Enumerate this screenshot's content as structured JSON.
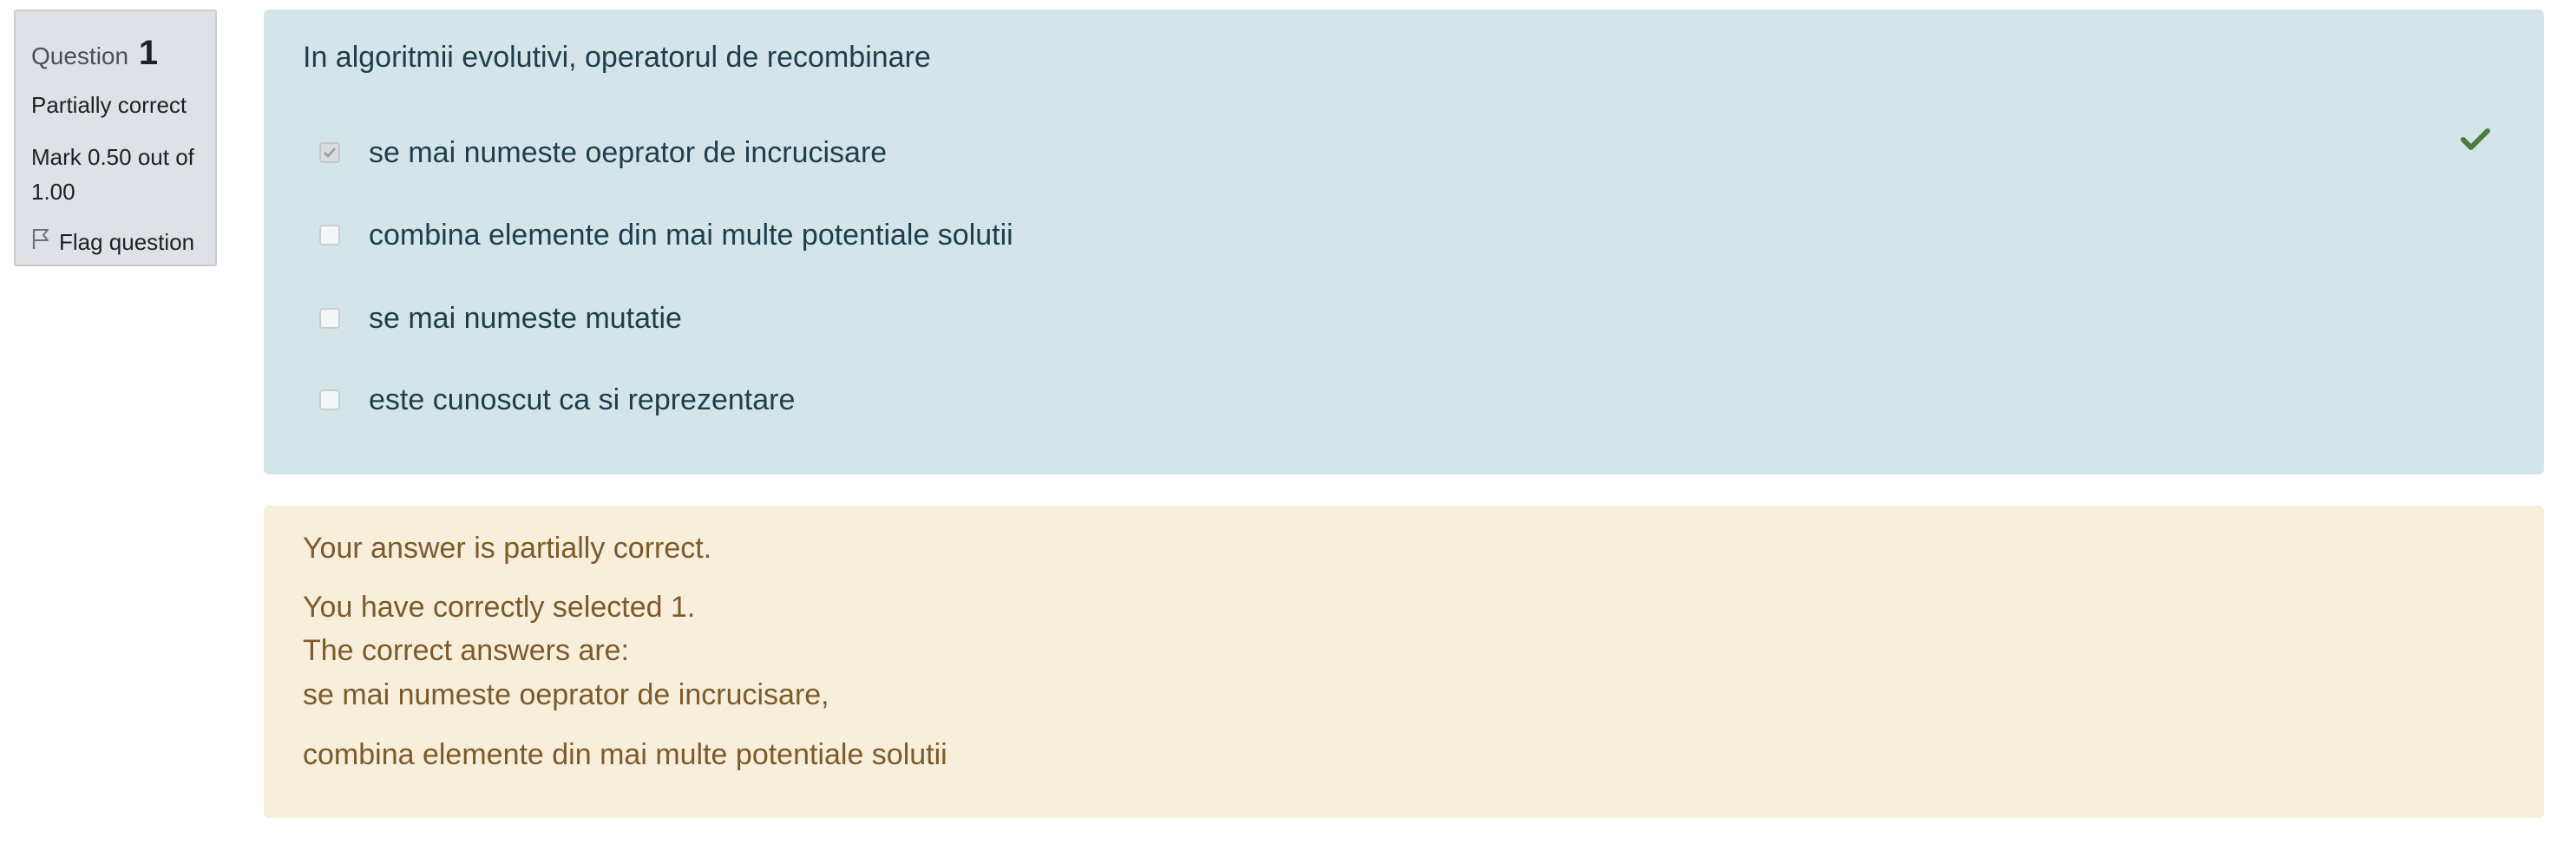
{
  "info": {
    "question_label": "Question",
    "question_number": "1",
    "state": "Partially correct",
    "grade": "Mark 0.50 out of 1.00",
    "flag_label": "Flag question"
  },
  "question": {
    "text": "In algoritmii evolutivi, operatorul de recombinare",
    "answers": [
      {
        "label": "se mai numeste oeprator de incrucisare",
        "checked": true,
        "correct": true
      },
      {
        "label": "combina elemente din mai multe potentiale solutii",
        "checked": false
      },
      {
        "label": "se mai numeste mutatie",
        "checked": false
      },
      {
        "label": "este cunoscut ca si reprezentare",
        "checked": false
      }
    ]
  },
  "feedback": {
    "summary": "Your answer is partially correct.",
    "selected": "You have correctly selected 1.",
    "correct_intro": "The correct answers are:",
    "correct_1": "se mai numeste oeprator de incrucisare,",
    "correct_2": "combina elemente din mai multe potentiale solutii"
  },
  "colors": {
    "question_bg": "#d4e5ea",
    "feedback_bg": "#f7eedc",
    "info_bg": "#dee2e6",
    "tick": "#4d7c3a"
  },
  "icons": {
    "flag": "flag-icon",
    "correct": "check-icon"
  }
}
